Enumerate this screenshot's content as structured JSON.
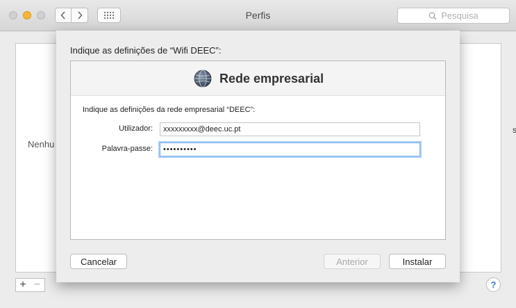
{
  "window": {
    "title": "Perfis",
    "search_placeholder": "Pesquisa"
  },
  "background": {
    "none_label": "Nenhu",
    "right_mark": "s",
    "add_label": "+",
    "remove_label": "−",
    "help_label": "?"
  },
  "sheet": {
    "header": "Indique as definições de “Wifi DEEC”:",
    "panel_title": "Rede empresarial",
    "description": "Indique as definições da rede empresarial “DEEC”:",
    "username_label": "Utilizador:",
    "username_value": "xxxxxxxxx@deec.uc.pt",
    "password_label": "Palavra-passe:",
    "password_value": "••••••••••",
    "cancel_label": "Cancelar",
    "previous_label": "Anterior",
    "install_label": "Instalar"
  },
  "colors": {
    "accent": "#3a7ee0",
    "focus_ring": "#a9ccf5",
    "minimize": "#f5b536"
  },
  "icons": {
    "back": "chevron-left-icon",
    "forward": "chevron-right-icon",
    "grid": "grid-icon",
    "search": "search-icon",
    "globe": "globe-icon"
  }
}
